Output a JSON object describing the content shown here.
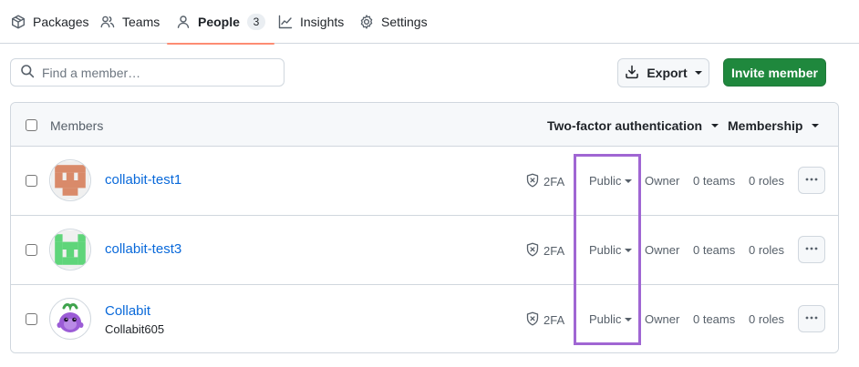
{
  "nav": {
    "tabs": [
      {
        "label": "Packages",
        "icon": "package-icon"
      },
      {
        "label": "Teams",
        "icon": "people-icon"
      },
      {
        "label": "People",
        "icon": "person-icon",
        "count": "3",
        "active": true
      },
      {
        "label": "Insights",
        "icon": "graph-icon"
      },
      {
        "label": "Settings",
        "icon": "gear-icon"
      }
    ]
  },
  "toolbar": {
    "search_placeholder": "Find a member…",
    "export_label": "Export",
    "invite_label": "Invite member"
  },
  "table": {
    "header": {
      "members": "Members",
      "two_factor": "Two-factor authentication",
      "membership": "Membership"
    },
    "rows": [
      {
        "name": "collabit-test1",
        "username": "",
        "twofa": "2FA",
        "visibility": "Public",
        "role": "Owner",
        "teams": "0 teams",
        "roles": "0 roles",
        "avatar_color": "#d98a6a"
      },
      {
        "name": "collabit-test3",
        "username": "",
        "twofa": "2FA",
        "visibility": "Public",
        "role": "Owner",
        "teams": "0 teams",
        "roles": "0 roles",
        "avatar_color": "#5fd57a"
      },
      {
        "name": "Collabit",
        "username": "Collabit605",
        "twofa": "2FA",
        "visibility": "Public",
        "role": "Owner",
        "teams": "0 teams",
        "roles": "0 roles",
        "avatar_color": "#9b5cd6"
      }
    ]
  },
  "colors": {
    "accent_link": "#0969da",
    "primary_button": "#1f883d",
    "active_tab_underline": "#fd8c73",
    "highlight_box": "#a066d3"
  }
}
